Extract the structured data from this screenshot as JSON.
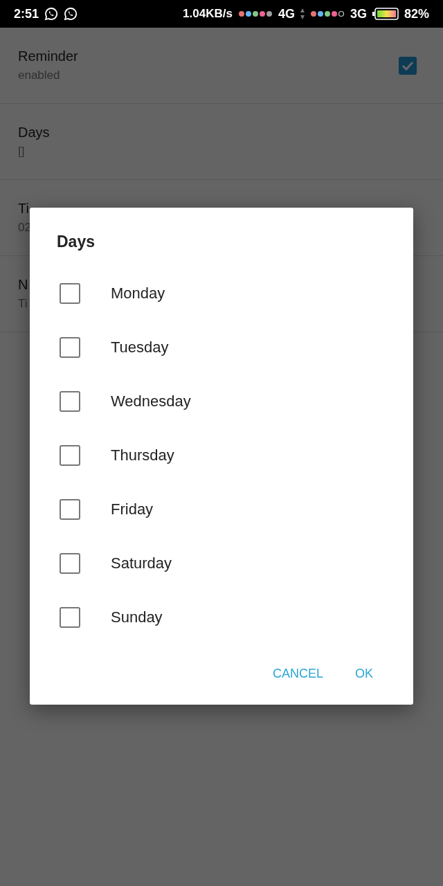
{
  "status_bar": {
    "time": "2:51",
    "speed": "1.04KB/s",
    "network_1": "4G",
    "network_2": "3G",
    "battery": "82%"
  },
  "settings": [
    {
      "title": "Reminder",
      "summary": "enabled",
      "kind": "checkbox",
      "checked": true
    },
    {
      "title": "Days",
      "summary": "[]",
      "kind": "text"
    },
    {
      "title": "Ti",
      "summary": "02",
      "kind": "text"
    },
    {
      "title": "N",
      "summary": "Ti",
      "kind": "text"
    }
  ],
  "dialog": {
    "title": "Days",
    "options": [
      {
        "label": "Monday",
        "checked": false
      },
      {
        "label": "Tuesday",
        "checked": false
      },
      {
        "label": "Wednesday",
        "checked": false
      },
      {
        "label": "Thursday",
        "checked": false
      },
      {
        "label": "Friday",
        "checked": false
      },
      {
        "label": "Saturday",
        "checked": false
      },
      {
        "label": "Sunday",
        "checked": false
      }
    ],
    "buttons": [
      "CANCEL",
      "OK"
    ]
  }
}
